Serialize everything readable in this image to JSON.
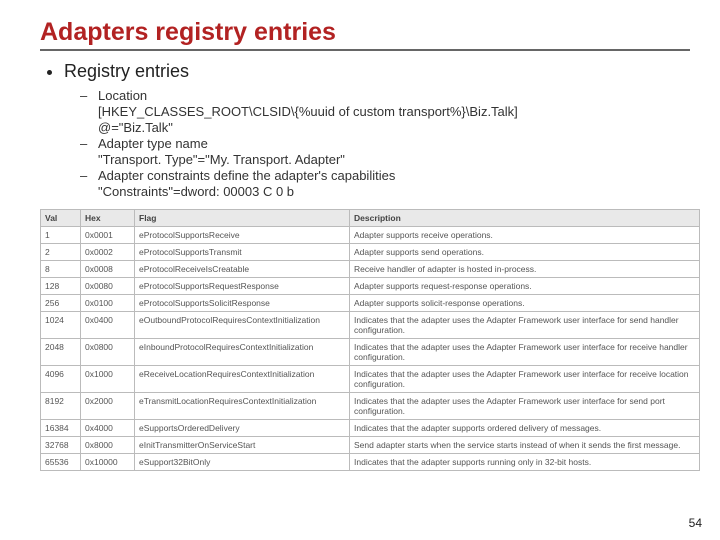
{
  "title": "Adapters registry entries",
  "bullet_top": "Registry entries",
  "sub": [
    {
      "dash": true,
      "text": "Location"
    },
    {
      "dash": false,
      "text": "[HKEY_CLASSES_ROOT\\CLSID\\{%uuid of custom transport%}\\Biz.Talk]"
    },
    {
      "dash": false,
      "text": "@=\"Biz.Talk\""
    },
    {
      "dash": true,
      "text": "Adapter type name"
    },
    {
      "dash": false,
      "text": "\"Transport. Type\"=\"My. Transport. Adapter\""
    },
    {
      "dash": true,
      "text": "Adapter constraints define the adapter's capabilities"
    },
    {
      "dash": false,
      "text": "\"Constraints\"=dword: 00003 C 0 b"
    }
  ],
  "page_number": "54",
  "chart_data": {
    "type": "table",
    "columns": [
      "Val",
      "Hex",
      "Flag",
      "Description"
    ],
    "rows": [
      {
        "Val": "1",
        "Hex": "0x0001",
        "Flag": "eProtocolSupportsReceive",
        "Description": "Adapter supports receive operations."
      },
      {
        "Val": "2",
        "Hex": "0x0002",
        "Flag": "eProtocolSupportsTransmit",
        "Description": "Adapter supports send operations."
      },
      {
        "Val": "8",
        "Hex": "0x0008",
        "Flag": "eProtocolReceiveIsCreatable",
        "Description": "Receive handler of adapter is hosted in-process."
      },
      {
        "Val": "128",
        "Hex": "0x0080",
        "Flag": "eProtocolSupportsRequestResponse",
        "Description": "Adapter supports request-response operations."
      },
      {
        "Val": "256",
        "Hex": "0x0100",
        "Flag": "eProtocolSupportsSolicitResponse",
        "Description": "Adapter supports solicit-response operations."
      },
      {
        "Val": "1024",
        "Hex": "0x0400",
        "Flag": "eOutboundProtocolRequiresContextInitialization",
        "Description": "Indicates that the adapter uses the Adapter Framework user interface for send handler configuration."
      },
      {
        "Val": "2048",
        "Hex": "0x0800",
        "Flag": "eInboundProtocolRequiresContextInitialization",
        "Description": "Indicates that the adapter uses the Adapter Framework user interface for receive handler configuration."
      },
      {
        "Val": "4096",
        "Hex": "0x1000",
        "Flag": "eReceiveLocationRequiresContextInitialization",
        "Description": "Indicates that the adapter uses the Adapter Framework user interface for receive location configuration."
      },
      {
        "Val": "8192",
        "Hex": "0x2000",
        "Flag": "eTransmitLocationRequiresContextInitialization",
        "Description": "Indicates that the adapter uses the Adapter Framework user interface for send port configuration."
      },
      {
        "Val": "16384",
        "Hex": "0x4000",
        "Flag": "eSupportsOrderedDelivery",
        "Description": "Indicates that the adapter supports ordered delivery of messages."
      },
      {
        "Val": "32768",
        "Hex": "0x8000",
        "Flag": "eInitTransmitterOnServiceStart",
        "Description": "Send adapter starts when the service starts instead of when it sends the first message."
      },
      {
        "Val": "65536",
        "Hex": "0x10000",
        "Flag": "eSupport32BitOnly",
        "Description": "Indicates that the adapter supports running only in 32-bit hosts."
      }
    ]
  }
}
